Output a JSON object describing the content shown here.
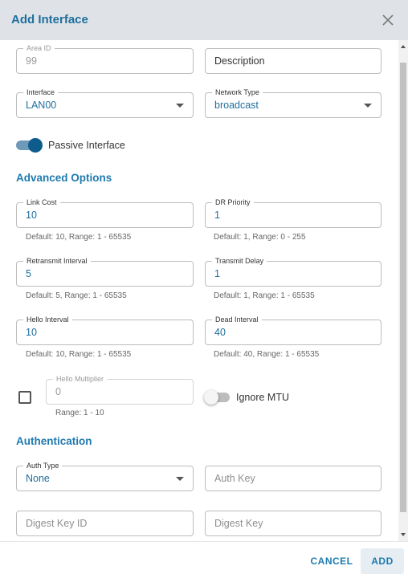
{
  "dialog": {
    "title": "Add Interface",
    "cancel_label": "CANCEL",
    "add_label": "ADD"
  },
  "fields": {
    "area_id": {
      "label": "Area ID",
      "value": "99"
    },
    "description": {
      "placeholder": "Description"
    },
    "interface": {
      "label": "Interface",
      "value": "LAN00"
    },
    "network_type": {
      "label": "Network Type",
      "value": "broadcast"
    },
    "passive_interface": {
      "label": "Passive Interface",
      "on": true
    }
  },
  "advanced": {
    "title": "Advanced Options",
    "link_cost": {
      "label": "Link Cost",
      "value": "10",
      "helper": "Default: 10, Range: 1 - 65535"
    },
    "dr_priority": {
      "label": "DR Priority",
      "value": "1",
      "helper": "Default: 1, Range: 0 - 255"
    },
    "retransmit_interval": {
      "label": "Retransmit Interval",
      "value": "5",
      "helper": "Default: 5, Range: 1 - 65535"
    },
    "transmit_delay": {
      "label": "Transmit Delay",
      "value": "1",
      "helper": "Default: 1, Range: 1 - 65535"
    },
    "hello_interval": {
      "label": "Hello Interval",
      "value": "10",
      "helper": "Default: 10, Range: 1 - 65535"
    },
    "dead_interval": {
      "label": "Dead Interval",
      "value": "40",
      "helper": "Default: 40, Range: 1 - 65535"
    },
    "hello_multiplier": {
      "label": "Hello Multiplier",
      "value": "0",
      "helper": "Range: 1 - 10",
      "checked": false
    },
    "ignore_mtu": {
      "label": "Ignore MTU",
      "on": false
    }
  },
  "authentication": {
    "title": "Authentication",
    "auth_type": {
      "label": "Auth Type",
      "value": "None"
    },
    "auth_key": {
      "placeholder": "Auth Key"
    },
    "digest_key_id": {
      "placeholder": "Digest Key ID"
    },
    "digest_key": {
      "placeholder": "Digest Key"
    }
  },
  "colors": {
    "accent": "#1f7aae",
    "header_bg": "#dfe3e7",
    "toggle_on": "#0e5c8c"
  },
  "icons": {
    "close": "close-icon",
    "dropdown": "chevron-down-icon"
  }
}
